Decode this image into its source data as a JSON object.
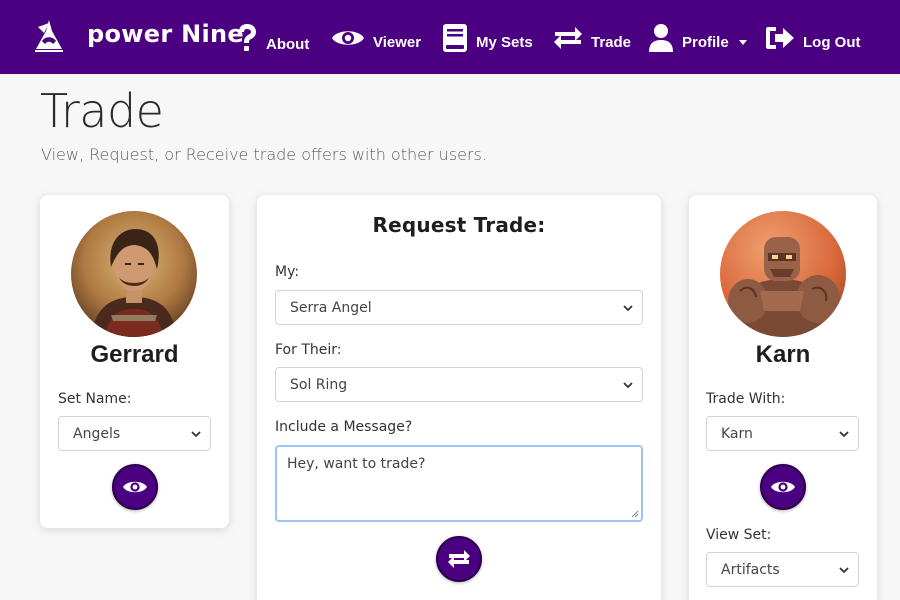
{
  "nav": {
    "brand": "power Nine",
    "items": [
      {
        "label": "About",
        "icon": "question-icon"
      },
      {
        "label": "Viewer",
        "icon": "eye-icon"
      },
      {
        "label": "My Sets",
        "icon": "book-icon"
      },
      {
        "label": "Trade",
        "icon": "exchange-icon"
      },
      {
        "label": "Profile",
        "icon": "user-icon"
      },
      {
        "label": "Log Out",
        "icon": "sign-out-icon"
      }
    ],
    "bg_color": "#4b0082"
  },
  "header": {
    "title": "Trade",
    "subtitle": "View, Request, or Receive trade offers with other users."
  },
  "left_card": {
    "user_name": "Gerrard",
    "set_label": "Set Name:",
    "set_value": "Angels"
  },
  "request": {
    "title": "Request Trade:",
    "my_label": "My:",
    "my_value": "Serra Angel",
    "for_label": "For Their:",
    "for_value": "Sol Ring",
    "message_label": "Include a Message?",
    "message_value": "Hey, want to trade?"
  },
  "right_card": {
    "user_name": "Karn",
    "trade_with_label": "Trade With:",
    "trade_with_value": "Karn",
    "view_set_label": "View Set:",
    "view_set_value": "Artifacts"
  }
}
